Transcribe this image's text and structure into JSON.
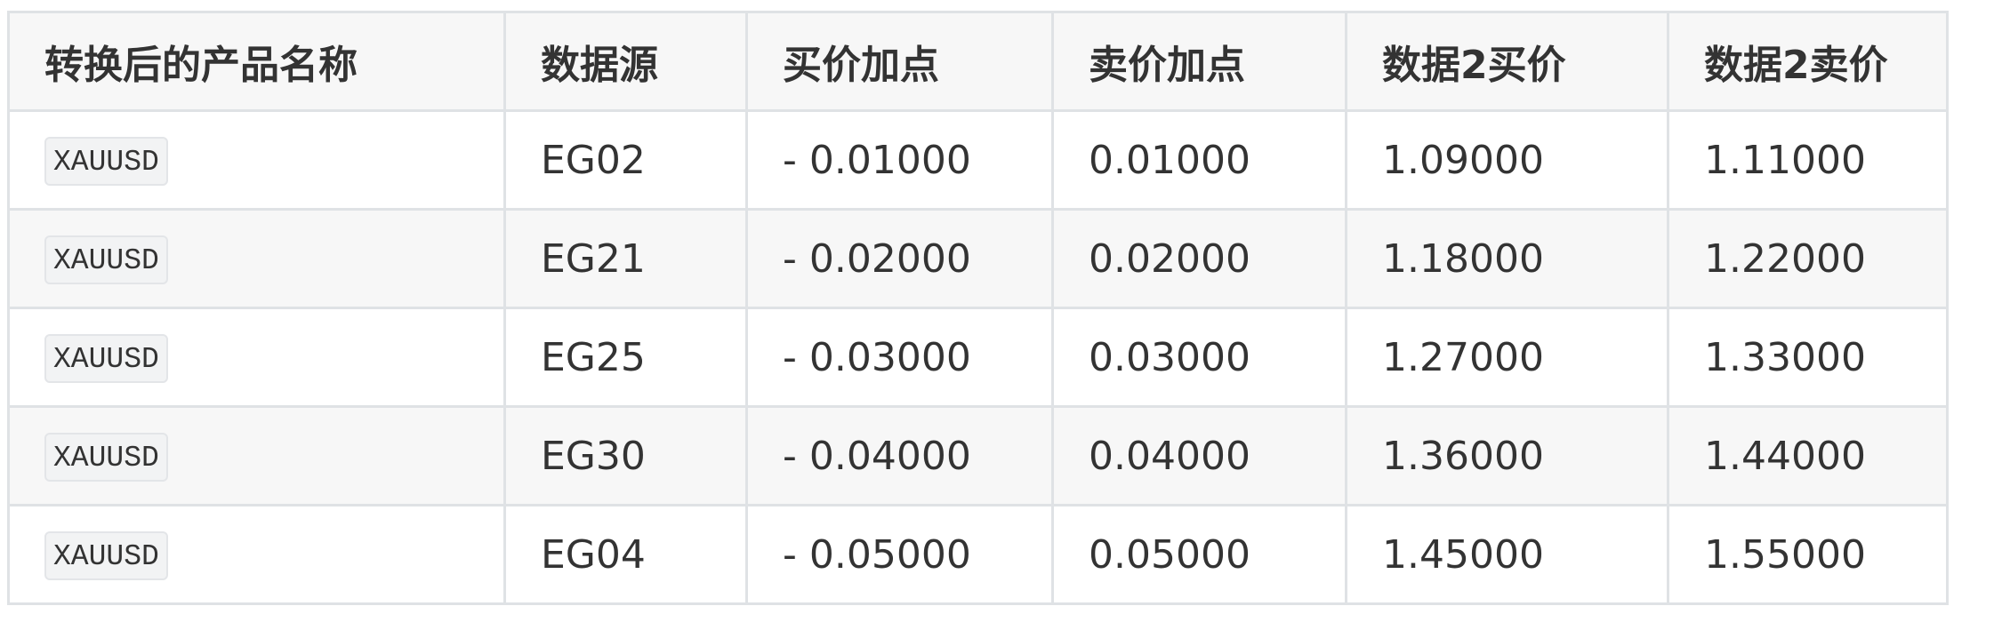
{
  "table": {
    "headers": [
      "转换后的产品名称",
      "数据源",
      "买价加点",
      "卖价加点",
      "数据2买价",
      "数据2卖价"
    ],
    "rows": [
      {
        "product": "XAUUSD",
        "source": "EG02",
        "bid_markup": "- 0.01000",
        "ask_markup": "0.01000",
        "data2_bid": "1.09000",
        "data2_ask": "1.11000"
      },
      {
        "product": "XAUUSD",
        "source": "EG21",
        "bid_markup": "- 0.02000",
        "ask_markup": "0.02000",
        "data2_bid": "1.18000",
        "data2_ask": "1.22000"
      },
      {
        "product": "XAUUSD",
        "source": "EG25",
        "bid_markup": "- 0.03000",
        "ask_markup": "0.03000",
        "data2_bid": "1.27000",
        "data2_ask": "1.33000"
      },
      {
        "product": "XAUUSD",
        "source": "EG30",
        "bid_markup": "- 0.04000",
        "ask_markup": "0.04000",
        "data2_bid": "1.36000",
        "data2_ask": "1.44000"
      },
      {
        "product": "XAUUSD",
        "source": "EG04",
        "bid_markup": "- 0.05000",
        "ask_markup": "0.05000",
        "data2_bid": "1.45000",
        "data2_ask": "1.55000"
      }
    ]
  }
}
